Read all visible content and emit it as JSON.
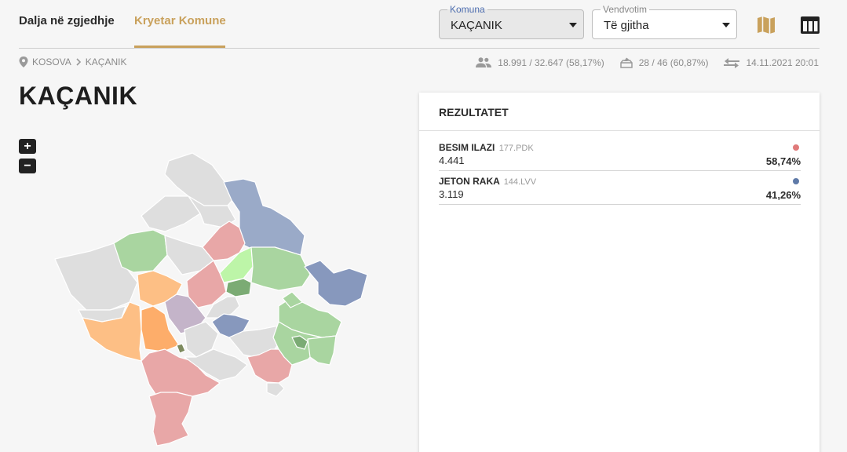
{
  "tabs": [
    {
      "label": "Dalja në zgjedhje",
      "active": false
    },
    {
      "label": "Kryetar Komune",
      "active": true
    }
  ],
  "filters": {
    "komuna": {
      "legend": "Komuna",
      "value": "KAÇANIK"
    },
    "vendvotim": {
      "legend": "Vendvotim",
      "value": "Të gjitha"
    }
  },
  "view_icons": [
    "map-icon",
    "table-icon"
  ],
  "breadcrumb": {
    "root": "KOSOVA",
    "current": "KAÇANIK"
  },
  "stats": {
    "turnout": "18.991 / 32.647 (58,17%)",
    "stations": "28 / 46 (60,87%)",
    "updated": "14.11.2021 20:01"
  },
  "page_title": "KAÇANIK",
  "map_controls": {
    "zoom_in": "+",
    "zoom_out": "−"
  },
  "results": {
    "title": "REZULTATET",
    "candidates": [
      {
        "name": "BESIM ILAZI",
        "party": "177.PDK",
        "votes": "4.441",
        "percent": "58,74%",
        "color": "#e07a7a"
      },
      {
        "name": "JETON RAKA",
        "party": "144.LVV",
        "votes": "3.119",
        "percent": "41,26%",
        "color": "#5f7aa8"
      }
    ]
  },
  "colors": {
    "accent": "#c9a15c",
    "pdk": "#e8a7a7",
    "lvv": "#9aaac8",
    "lvv_dark": "#8798bd",
    "ldk_orange": "#fdbf85",
    "green": "#a9d5a0",
    "grey": "#dedede"
  }
}
